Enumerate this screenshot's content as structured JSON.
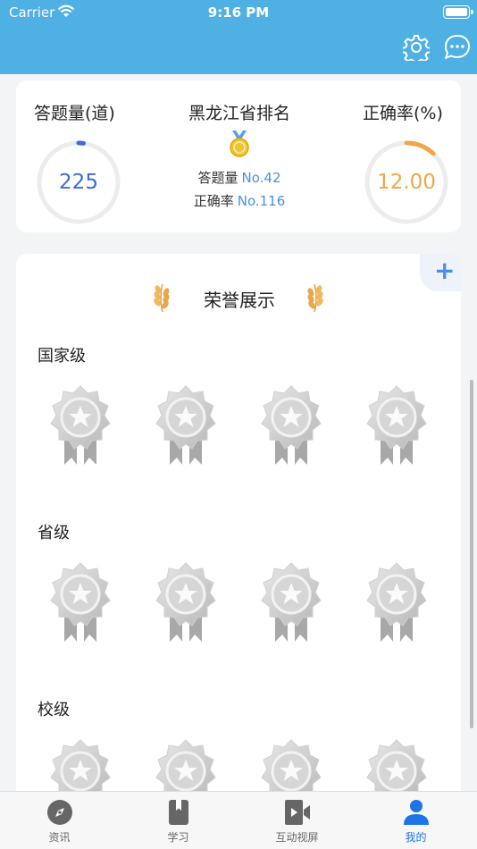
{
  "status_bar": {
    "carrier": "Carrier",
    "time": "9:16 PM"
  },
  "stats": {
    "questions": {
      "title": "答题量(道)",
      "value": "225",
      "progress": 0.02,
      "color": "#3b6bd9"
    },
    "ranking": {
      "title": "黑龙江省排名",
      "questions_label": "答题量",
      "questions_rank": "No.42",
      "accuracy_label": "正确率",
      "accuracy_rank": "No.116"
    },
    "accuracy": {
      "title": "正确率(%)",
      "value": "12.00",
      "progress": 0.12,
      "color": "#f0a64a"
    }
  },
  "honor": {
    "title": "荣誉展示",
    "add_label": "+",
    "levels": [
      {
        "title": "国家级"
      },
      {
        "title": "省级"
      },
      {
        "title": "校级"
      }
    ]
  },
  "tabs": [
    {
      "label": "资讯",
      "icon": "compass-icon"
    },
    {
      "label": "学习",
      "icon": "book-icon"
    },
    {
      "label": "互动视屏",
      "icon": "video-icon"
    },
    {
      "label": "我的",
      "icon": "person-icon",
      "active": true
    }
  ]
}
